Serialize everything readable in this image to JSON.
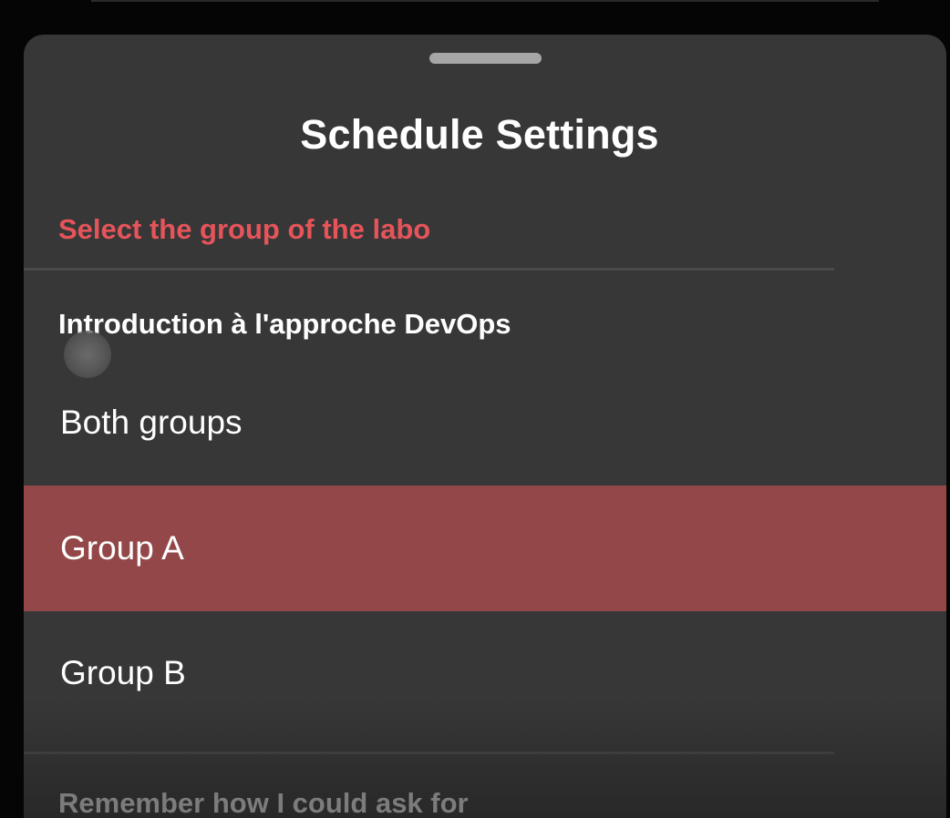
{
  "sheet": {
    "title": "Schedule Settings",
    "section_heading": "Select the group of the labo",
    "course_title": "Introduction à l'approche DevOps",
    "options": [
      {
        "label": "Both groups",
        "selected": false
      },
      {
        "label": "Group A",
        "selected": true
      },
      {
        "label": "Group B",
        "selected": false
      }
    ],
    "next_section_partial": "Remember how I could ask for"
  },
  "colors": {
    "sheet_background": "#373737",
    "accent_heading": "#e5545a",
    "selected_option": "#934748",
    "text": "#ffffff"
  }
}
